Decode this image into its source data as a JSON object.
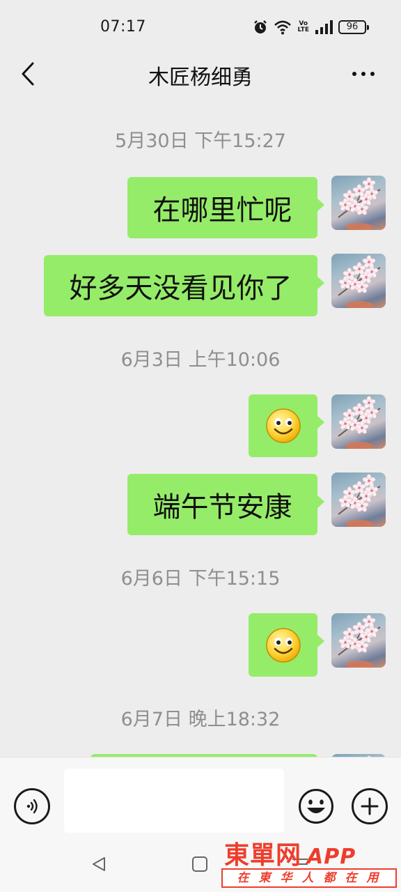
{
  "status_bar": {
    "time": "07:17",
    "icons": [
      "alarm-icon",
      "wifi-icon",
      "volte-icon",
      "signal-icon",
      "battery-icon"
    ],
    "volte_top": "Vo",
    "volte_bottom": "LTE",
    "battery": "96"
  },
  "header": {
    "title": "木匠杨细勇",
    "back_icon": "chevron-left-icon",
    "more_icon": "more-dots-icon"
  },
  "chat": {
    "timestamps": [
      "5月30日 下午15:27",
      "6月3日 上午10:06",
      "6月6日 下午15:15",
      "6月7日 晚上18:32"
    ],
    "messages": [
      {
        "type": "text",
        "text": "在哪里忙呢"
      },
      {
        "type": "text",
        "text": "好多天没看见你了"
      },
      {
        "type": "emoji",
        "emoji": "smile-emoji"
      },
      {
        "type": "text",
        "text": "端午节安康"
      },
      {
        "type": "emoji",
        "emoji": "smile-emoji"
      }
    ],
    "bubble_color": "#95ec69",
    "background_color": "#ededed",
    "timestamp_color": "#8e8e8e"
  },
  "input_bar": {
    "voice_icon": "voice-icon",
    "input_value": "",
    "emoji_icon": "emoji-icon",
    "plus_icon": "plus-icon"
  },
  "nav_bar": {
    "icons": [
      "nav-back-icon",
      "nav-home-icon",
      "nav-recents-icon"
    ]
  },
  "watermark": {
    "title": "東單网",
    "app": "APP",
    "slogan": "在東华人都在用",
    "color": "#ee3d2d"
  }
}
